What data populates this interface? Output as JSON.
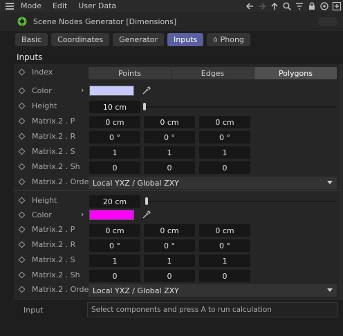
{
  "menubar": {
    "items": [
      "Mode",
      "Edit",
      "User Data"
    ]
  },
  "toolbar_icons": [
    "arrow-left-icon",
    "arrow-right-icon",
    "arrow-up-icon",
    "search-icon",
    "filter-icon",
    "lock-icon",
    "target-icon",
    "add-icon"
  ],
  "title": "Scene Nodes Generator [Dimensions]",
  "tabs": [
    {
      "label": "Basic",
      "active": false
    },
    {
      "label": "Coordinates",
      "active": false
    },
    {
      "label": "Generator",
      "active": false
    },
    {
      "label": "Inputs",
      "active": true
    },
    {
      "label": "Phong",
      "active": false
    }
  ],
  "section_title": "Inputs",
  "index": {
    "label": "Index",
    "options": [
      "Points",
      "Edges",
      "Polygons"
    ],
    "selected": "Polygons"
  },
  "group1": {
    "color": {
      "label": "Color",
      "value": "#c9c8ff"
    },
    "height": {
      "label": "Height",
      "value": "10 cm",
      "slider_fraction": 0.0
    },
    "matrix_p": {
      "label": "Matrix.2 . P",
      "values": [
        "0 cm",
        "0 cm",
        "0 cm"
      ]
    },
    "matrix_r": {
      "label": "Matrix.2 . R",
      "values": [
        "0 °",
        "0 °",
        "0 °"
      ]
    },
    "matrix_s": {
      "label": "Matrix.2 . S",
      "values": [
        "1",
        "1",
        "1"
      ]
    },
    "matrix_sh": {
      "label": "Matrix.2 . Sh",
      "values": [
        "0",
        "0",
        "0"
      ]
    },
    "matrix_order": {
      "label": "Matrix.2 . Order",
      "value": "Local YXZ / Global ZXY"
    }
  },
  "group2": {
    "height": {
      "label": "Height",
      "value": "20 cm",
      "slider_fraction": 0.01
    },
    "color": {
      "label": "Color",
      "value": "#ff00ff"
    },
    "matrix_p": {
      "label": "Matrix.2 . P",
      "values": [
        "0 cm",
        "0 cm",
        "0 cm"
      ]
    },
    "matrix_r": {
      "label": "Matrix.2 . R",
      "values": [
        "0 °",
        "0 °",
        "0 °"
      ]
    },
    "matrix_s": {
      "label": "Matrix.2 . S",
      "values": [
        "1",
        "1",
        "1"
      ]
    },
    "matrix_sh": {
      "label": "Matrix.2 . Sh",
      "values": [
        "0",
        "0",
        "0"
      ]
    },
    "matrix_order": {
      "label": "Matrix.2 . Order",
      "value": "Local YXZ / Global ZXY"
    }
  },
  "input": {
    "label": "Input",
    "value": "Select components and press A to run calculation"
  },
  "colors": {
    "accent": "#5a5fa0",
    "panel": "#262626",
    "field": "#171717"
  }
}
